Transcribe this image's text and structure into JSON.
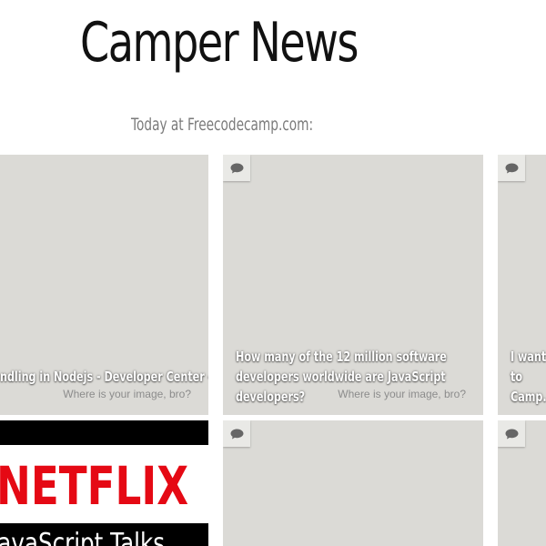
{
  "header": {
    "title": "Camper News",
    "subtitle": "Today at Freecodecamp.com:"
  },
  "icons": {
    "comment": "comment-icon"
  },
  "colors": {
    "card_placeholder": "#dbdad6",
    "netflix_red": "#e50914"
  },
  "cards": [
    {
      "headline": "ndling in Nodejs - Developer Center -",
      "image_alt": "Where is your image, bro?"
    },
    {
      "headline": "How many of the 12 million software developers worldwide are JavaScript developers?",
      "image_alt": "Where is your image, bro?"
    },
    {
      "headline": "I want to Camp."
    },
    {
      "logo_text": "NETFLIX",
      "banner_text": "JavaScript Talks"
    },
    {},
    {}
  ]
}
